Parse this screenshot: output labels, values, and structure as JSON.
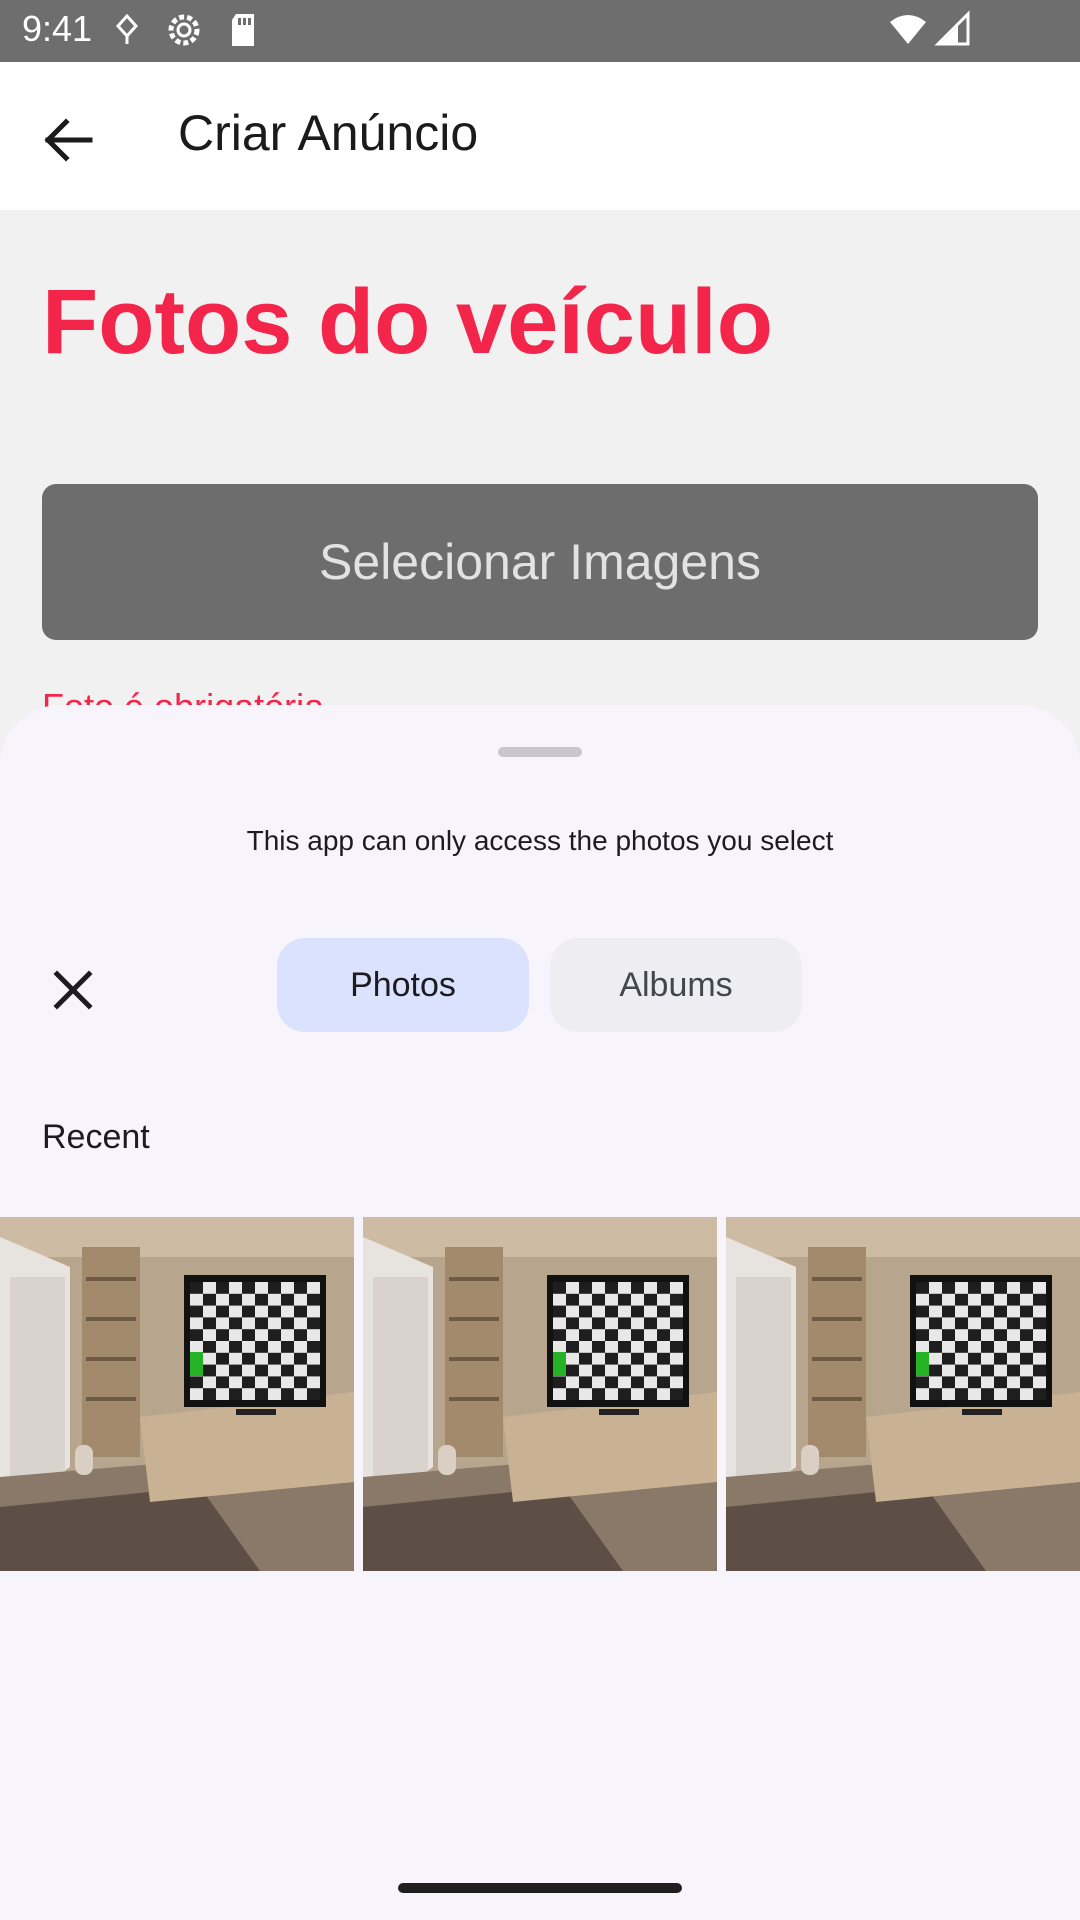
{
  "status_bar": {
    "time": "9:41",
    "icons": [
      "data-saver-icon",
      "settings-gear-icon",
      "sd-card-icon",
      "wifi-icon",
      "cellular-signal-icon"
    ]
  },
  "app_bar": {
    "back_icon": "arrow-back-icon",
    "title": "Criar Anúncio"
  },
  "content": {
    "section_title": "Fotos do veículo",
    "select_button_label": "Selecionar Imagens",
    "error_text": "Foto é obrigatória"
  },
  "picker_sheet": {
    "notice": "This app can only access the photos you select",
    "close_icon": "close-icon",
    "tabs": [
      {
        "label": "Photos",
        "selected": true
      },
      {
        "label": "Albums",
        "selected": false
      }
    ],
    "section_label": "Recent",
    "photos": [
      {
        "subject": "living room with tv"
      },
      {
        "subject": "living room with tv"
      },
      {
        "subject": "living room with tv"
      }
    ]
  },
  "colors": {
    "accent": "#f4254b",
    "button_bg": "#6d6d6d",
    "tab_selected_bg": "#dae2fd",
    "sheet_bg": "#f7f5fb",
    "status_bar_bg": "#6e6e6e"
  }
}
